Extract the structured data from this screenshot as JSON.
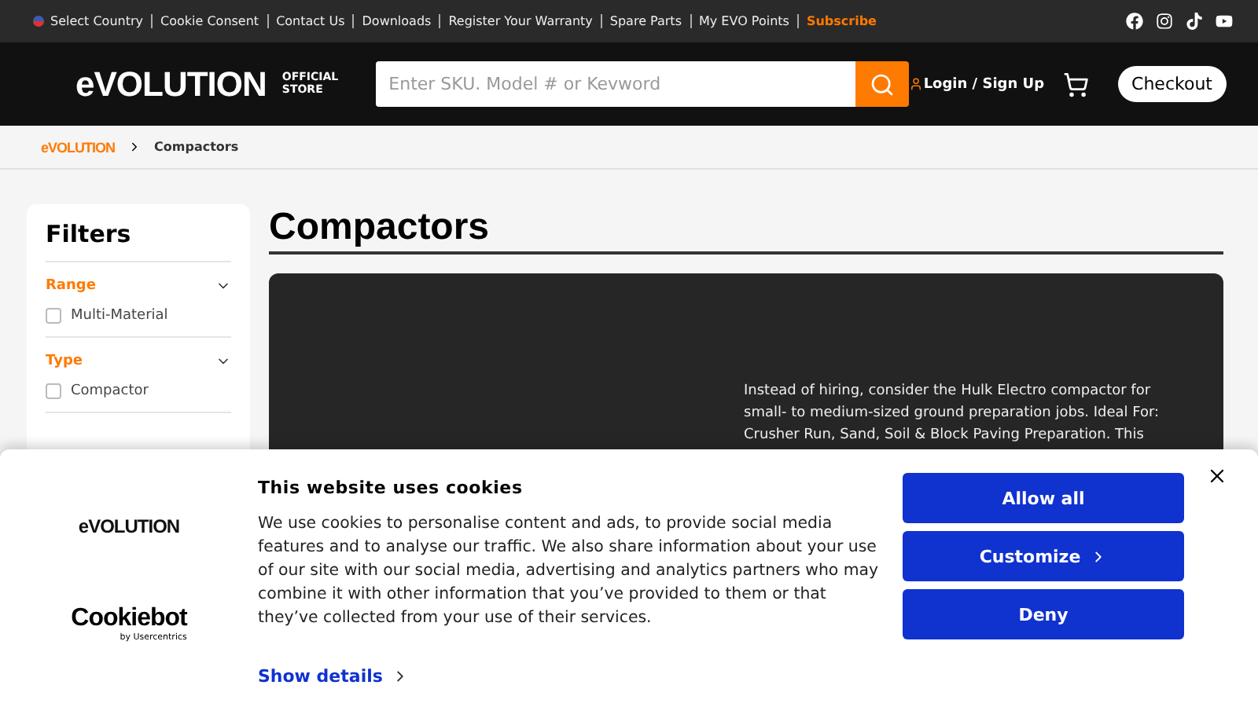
{
  "top_bar": {
    "links": [
      {
        "label": "Select Country",
        "kind": "country"
      },
      {
        "label": "Cookie Consent",
        "kind": "link"
      },
      {
        "label": "Contact Us",
        "kind": "link"
      },
      {
        "label": "Downloads",
        "kind": "link"
      },
      {
        "label": "Register Your Warranty",
        "kind": "link"
      },
      {
        "label": "Spare Parts",
        "kind": "link"
      },
      {
        "label": "My EVO Points",
        "kind": "link"
      },
      {
        "label": "Subscribe",
        "kind": "highlight"
      }
    ]
  },
  "header": {
    "logo": "eVOLUTION",
    "logo_tag": "OFFICIAL STORE",
    "search": {
      "placeholder": "Enter SKU. Model # or Kevword"
    },
    "login": "Login / Sign Up",
    "checkout": "Checkout"
  },
  "breadcrumb": {
    "home_logo": "eVOLUTION",
    "current": "Compactors"
  },
  "filters": {
    "title": "Filters",
    "groups": [
      {
        "label": "Range",
        "expanded": true,
        "options": [
          {
            "label": "Multi-Material",
            "checked": false
          }
        ]
      },
      {
        "label": "Type",
        "expanded": true,
        "options": [
          {
            "label": "Compactor",
            "checked": false
          }
        ]
      }
    ]
  },
  "page_title": "Compactors",
  "hero": {
    "description": "Instead of hiring, consider the Hulk Electro compactor for small- to medium-sized ground preparation jobs. Ideal For: Crusher Run, Sand, Soil & Block Paving Preparation. This"
  },
  "cookie_banner": {
    "logo": "eVOLUTION",
    "provider": "Cookiebot",
    "provider_sub": "by Usercentrics",
    "title": "This website uses cookies",
    "body": "We use cookies to personalise content and ads, to provide social media features and to analyse our traffic. We also share information about your use of our site with our social media, advertising and analytics partners who may combine it with other information that you’ve provided to them or that they’ve collected from your use of their services.",
    "details_link": "Show details",
    "buttons": [
      {
        "label": "Allow all",
        "kind": "plain"
      },
      {
        "label": "Customize",
        "kind": "more"
      },
      {
        "label": "Deny",
        "kind": "plain"
      }
    ]
  }
}
